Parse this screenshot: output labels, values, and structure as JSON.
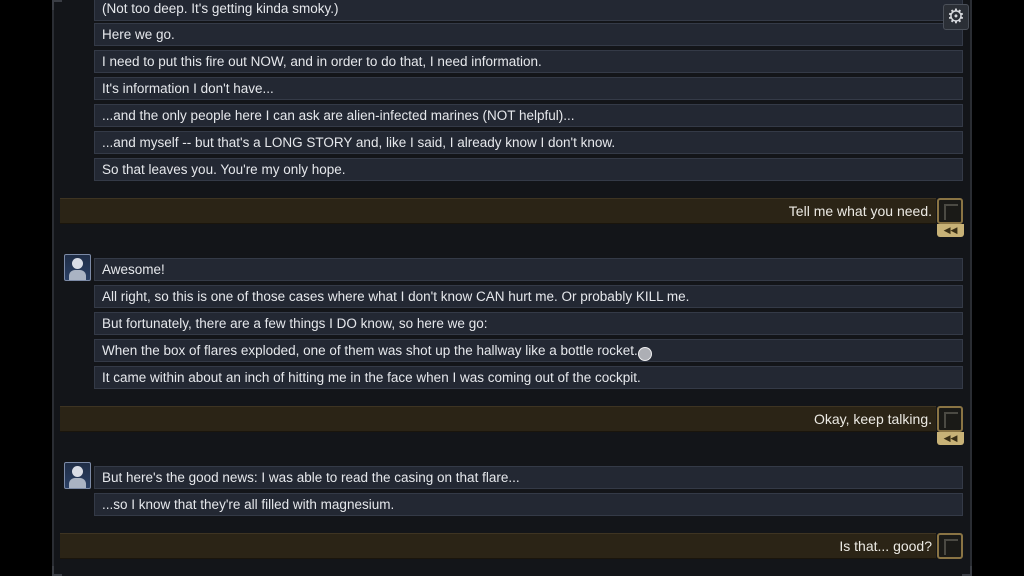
{
  "settings": {
    "icon": "gear-icon"
  },
  "transcript": {
    "block1": [
      "(Not too deep. It's getting kinda smoky.)",
      "Here we go.",
      "I need to put this fire out NOW, and in order to do that, I need information.",
      "It's information I don't have...",
      "...and the only people here I can ask are alien-infected marines (NOT helpful)...",
      "...and myself -- but that's a LONG STORY and, like I said, I already know I don't know.",
      "So that leaves you. You're my only hope."
    ],
    "reply1": "Tell me what you need.",
    "block2": [
      "Awesome!",
      "All right, so this is one of those cases where what I don't know CAN hurt me. Or probably KILL me.",
      "But fortunately, there are a few things I DO know, so here we go:",
      "When the box of flares exploded, one of them was shot up the hallway like a bottle rocket.",
      "It came within about an inch of hitting me in the face when I was coming out of the cockpit."
    ],
    "reply2": "Okay, keep talking.",
    "block3": [
      "But here's the good news: I was able to read the casing on that flare...",
      "...so I know that they're all filled with magnesium."
    ],
    "reply3": "Is that... good?",
    "rewind_symbol": "◀◀"
  }
}
